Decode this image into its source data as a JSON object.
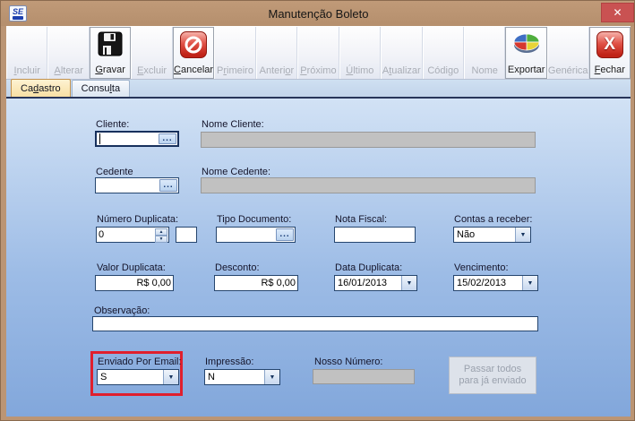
{
  "window": {
    "title": "Manutenção Boleto",
    "app_icon_text": "SE",
    "close_glyph": "✕"
  },
  "colors": {
    "titlebar_bg": "#bb9574",
    "close_button_red": "#c95252",
    "content_gradient_top": "#d2e2f5",
    "content_gradient_bottom": "#82a7db",
    "active_tab_bg": "#fbe9bc",
    "disabled_field_bg": "#c1c1c1",
    "highlight_red": "#e01f2d",
    "toolbar_icon_red": "#d43b30"
  },
  "glyphs": {
    "ellipsis": "...",
    "dropdown_arrow": "▼",
    "spin_up": "▲",
    "spin_down": "▼"
  },
  "toolbar": {
    "buttons": [
      {
        "label": "Incluir",
        "label_html": "<u>I</u>ncluir",
        "enabled": false,
        "icon": null
      },
      {
        "label": "Alterar",
        "label_html": "<u>A</u>lterar",
        "enabled": false,
        "icon": null
      },
      {
        "label": "Gravar",
        "label_html": "<u>G</u>ravar",
        "enabled": true,
        "icon": "floppy-disk"
      },
      {
        "label": "Excluir",
        "label_html": "<u>E</u>xcluir",
        "enabled": false,
        "icon": null
      },
      {
        "label": "Cancelar",
        "label_html": "<u>C</u>ancelar",
        "enabled": true,
        "icon": "cancel-sign"
      },
      {
        "label": "Primeiro",
        "label_html": "P<u>r</u>imeiro",
        "enabled": false,
        "icon": null
      },
      {
        "label": "Anterior",
        "label_html": "Anteri<u>o</u>r",
        "enabled": false,
        "icon": null
      },
      {
        "label": "Próximo",
        "label_html": "<u>P</u>róximo",
        "enabled": false,
        "icon": null
      },
      {
        "label": "Último",
        "label_html": "<u>Ú</u>ltimo",
        "enabled": false,
        "icon": null
      },
      {
        "label": "Atualizar",
        "label_html": "A<u>t</u>ualizar",
        "enabled": false,
        "icon": null
      },
      {
        "label": "Código",
        "label_html": "Código",
        "enabled": false,
        "icon": null
      },
      {
        "label": "Nome",
        "label_html": "Nome",
        "enabled": false,
        "icon": null
      },
      {
        "label": "Exportar",
        "label_html": "Exportar",
        "enabled": true,
        "icon": "pie-chart"
      },
      {
        "label": "Genérica",
        "label_html": "Genérica",
        "enabled": false,
        "icon": null
      },
      {
        "label": "Fechar",
        "label_html": "<u>F</u>echar",
        "enabled": true,
        "icon": "red-x"
      }
    ]
  },
  "tabs": [
    {
      "label": "Cadastro",
      "label_html": "Ca<u>d</u>astro",
      "active": true
    },
    {
      "label": "Consulta",
      "label_html": "Consu<u>l</u>ta",
      "active": false
    }
  ],
  "form": {
    "cliente": {
      "label": "Cliente:",
      "value": "",
      "focused": true
    },
    "nome_cliente": {
      "label": "Nome Cliente:",
      "value": "",
      "disabled": true
    },
    "cedente": {
      "label": "Cedente",
      "value": ""
    },
    "nome_cedente": {
      "label": "Nome Cedente:",
      "value": "",
      "disabled": true
    },
    "numero_duplicata": {
      "label": "Número Duplicata:",
      "value": "0"
    },
    "numero_duplicata_aux": {
      "value": ""
    },
    "tipo_documento": {
      "label": "Tipo Documento:",
      "value": ""
    },
    "nota_fiscal": {
      "label": "Nota Fiscal:",
      "value": ""
    },
    "contas_a_receber": {
      "label": "Contas a receber:",
      "value": "Não"
    },
    "valor_duplicata": {
      "label": "Valor Duplicata:",
      "value": "R$ 0,00"
    },
    "desconto": {
      "label": "Desconto:",
      "value": "R$ 0,00"
    },
    "data_duplicata": {
      "label": "Data Duplicata:",
      "value": "16/01/2013"
    },
    "vencimento": {
      "label": "Vencimento:",
      "value": "15/02/2013"
    },
    "observacao": {
      "label": "Observação:",
      "value": ""
    },
    "enviado_por_email": {
      "label": "Enviado Por Email:",
      "value": "S",
      "highlighted": true
    },
    "impressao": {
      "label": "Impressão:",
      "value": "N"
    },
    "nosso_numero": {
      "label": "Nosso Número:",
      "value": "",
      "disabled": true
    },
    "passar_todos_button": {
      "label": "Passar todos para já enviado",
      "enabled": false
    }
  }
}
